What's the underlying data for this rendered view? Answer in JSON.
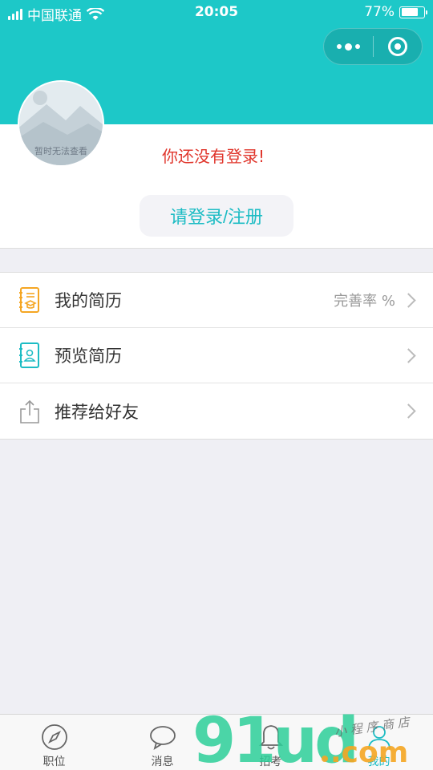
{
  "status_bar": {
    "carrier": "中国联通",
    "time": "20:05",
    "battery_percent": "77%",
    "battery_level": 0.77
  },
  "profile": {
    "avatar_placeholder_text": "暂时无法查看",
    "login_status": "你还没有登录!",
    "login_button": "请登录/注册"
  },
  "menu": {
    "items": [
      {
        "label": "我的简历",
        "extra": "完善率 %",
        "icon": "resume-icon"
      },
      {
        "label": "预览简历",
        "extra": "",
        "icon": "contact-book-icon"
      },
      {
        "label": "推荐给好友",
        "extra": "",
        "icon": "share-icon"
      }
    ]
  },
  "tabbar": {
    "tabs": [
      {
        "label": "职位",
        "icon": "compass-icon",
        "active": false
      },
      {
        "label": "消息",
        "icon": "chat-bubble-icon",
        "active": false
      },
      {
        "label": "招考",
        "icon": "bell-icon",
        "active": false
      },
      {
        "label": "我的",
        "icon": "person-icon",
        "active": true
      }
    ]
  },
  "watermark": {
    "logo_text": "91ud.com",
    "tagline": "小程序商店"
  },
  "colors": {
    "primary": "#1dc8c8",
    "accent_text": "#1dbcc4",
    "warning_text": "#e0352b",
    "resume_icon": "#f5a623",
    "preview_icon": "#1dbcc4"
  }
}
